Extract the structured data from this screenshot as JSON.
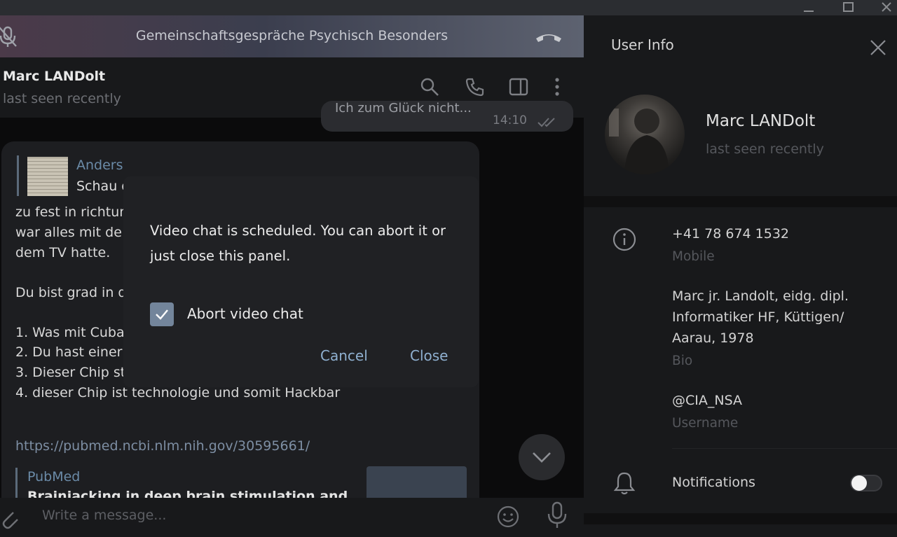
{
  "call_bar": {
    "title": "Gemeinschaftsgespräche Psychisch Besonders"
  },
  "chat_header": {
    "name": "Marc LANDolt",
    "status": "last seen recently"
  },
  "messages": {
    "top_bubble_text": "Ich zum Glück nicht...",
    "top_bubble_time": "14:10",
    "reply_quote": {
      "author": "Anders",
      "text": "Schau d"
    },
    "lines": [
      "zu fest in richtun",
      "war alles mit de",
      "dem TV hatte.",
      "Du bist grad in d",
      "1. Was mit Cuba",
      "2. Du hast einer",
      "3. Dieser Chip st",
      "4. dieser Chip ist technologie und somit Hackbar"
    ],
    "link": "https://pubmed.ncbi.nlm.nih.gov/30595661/",
    "preview": {
      "site": "PubMed",
      "title": "Brainjacking in deep brain stimulation and"
    }
  },
  "composer": {
    "placeholder": "Write a message..."
  },
  "modal": {
    "text": "Video chat is scheduled. You can abort it or just close this panel.",
    "checkbox_label": "Abort video chat",
    "checkbox_checked": true,
    "cancel_label": "Cancel",
    "close_label": "Close"
  },
  "user_info": {
    "title": "User Info",
    "name": "Marc LANDolt",
    "status": "last seen recently",
    "phone": "+41 78 674 1532",
    "phone_label": "Mobile",
    "bio": "Marc jr. Landolt, eidg. dipl. Informatiker HF, Küttigen/ Aarau, 1978",
    "bio_label": "Bio",
    "username": "@CIA_NSA",
    "username_label": "Username",
    "notifications_label": "Notifications",
    "notifications_on": false
  },
  "colors": {
    "accent": "#8fb0d0",
    "checkbox": "#73859b",
    "panel": "#18191b",
    "dialog": "#202124"
  }
}
